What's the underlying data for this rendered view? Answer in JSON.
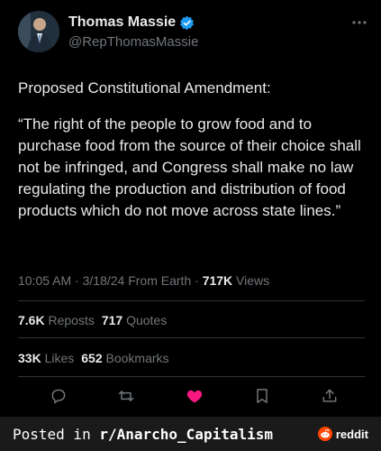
{
  "author": {
    "name": "Thomas Massie",
    "handle": "@RepThomasMassie",
    "verified": true,
    "verified_color": "#1d9bf0"
  },
  "tweet": {
    "heading": "Proposed Constitutional Amendment:",
    "quote": "“The right of the people to grow food and to purchase food from the source of their choice shall not be infringed, and Congress shall make no law regulating the production and distribution of food products which do not move across state lines.”"
  },
  "meta": {
    "time": "10:05 AM",
    "date": "3/18/24",
    "source": "From Earth",
    "views_count": "717K",
    "views_label": "Views"
  },
  "stats": {
    "reposts_count": "7.6K",
    "reposts_label": "Reposts",
    "quotes_count": "717",
    "quotes_label": "Quotes",
    "likes_count": "33K",
    "likes_label": "Likes",
    "bookmarks_count": "652",
    "bookmarks_label": "Bookmarks"
  },
  "actions": {
    "icons": [
      "reply-icon",
      "repost-icon",
      "like-icon",
      "bookmark-icon",
      "share-icon"
    ],
    "like_color": "#f91880",
    "icon_color": "#71767b"
  },
  "footer": {
    "posted_prefix": "Posted in",
    "subreddit": "r/Anarcho_Capitalism",
    "brand": "reddit",
    "brand_color": "#ff4500"
  }
}
